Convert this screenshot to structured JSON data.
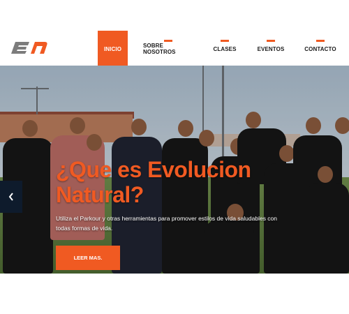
{
  "header": {
    "logo_alt": "en",
    "accent": "#f05a22",
    "nav": [
      {
        "label": "INICIO",
        "active": true
      },
      {
        "label": "SOBRE NOSOTROS"
      },
      {
        "label": "CLASES"
      },
      {
        "label": "EVENTOS"
      },
      {
        "label": "CONTACTO"
      }
    ]
  },
  "hero": {
    "title": "¿Que es Evolucion Natural?",
    "description": "Utiliza el Parkour y otras herramientas para promover estilos de vida saludables con todas formas de vida.",
    "cta_label": "LEER MAS.",
    "prev_icon": "chevron-left-icon",
    "image": "group-photo"
  }
}
